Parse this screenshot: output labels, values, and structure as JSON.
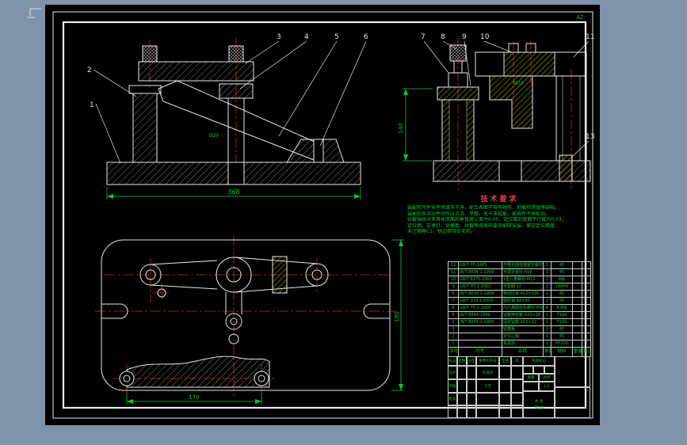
{
  "sheet": {
    "corner_label": "A2"
  },
  "front_view": {
    "callouts": [
      "1",
      "2",
      "3",
      "4",
      "5",
      "6"
    ],
    "dim_width": "368",
    "bore": "Ø20"
  },
  "side_view": {
    "callouts": [
      "7",
      "8",
      "9",
      "10",
      "11",
      "13"
    ],
    "dim_height": "140",
    "thread": "M10"
  },
  "plan_view": {
    "dim_right": "190",
    "dim_bottom": "170"
  },
  "tech_req": {
    "title": "技术要求",
    "lines": [
      "装配前所有零件须清洗干净，配合表面不得有碰伤、划痕和锈蚀等缺陷。",
      "装配后各活动件动作应灵活、平稳、无卡滞现象，紧固件不得松动。",
      "钻套轴线对夹具体底面的垂直度公差为0.05，定位面对底面平行度为0.03。",
      "定位销、支承钉、钻模板、衬套等按图样要求配研安装，保证定位精度。",
      "未注倒角C1，锐边倒钝去毛刺。"
    ]
  },
  "bom": {
    "headers": [
      "序号",
      "代号",
      "名称",
      "数量",
      "材料",
      "重量",
      "备注"
    ],
    "rows": [
      [
        "12",
        "GB/T 75-1985",
        "开槽长圆柱端紧定螺钉 M6×20",
        "1",
        "45",
        "",
        ""
      ],
      [
        "11",
        "JB/T 8004.1-1999",
        "可调支承钉 A16",
        "1",
        "45",
        "",
        ""
      ],
      [
        "10",
        "GB/T 6170-2000",
        "1型六角螺母 M12",
        "2",
        "8级",
        "",
        ""
      ],
      [
        "9",
        "GB/T 97.1-2002",
        "平垫圈 12",
        "2",
        "140HV",
        "",
        ""
      ],
      [
        "8",
        "JB/T 8010.1-1999",
        "移动压板 A12×100",
        "1",
        "45",
        "",
        ""
      ],
      [
        "7",
        "GB/T 119.1-2000",
        "圆柱销 A8×40",
        "2",
        "35",
        "",
        ""
      ],
      [
        "6",
        "GB/T 70.1-2000",
        "内六角圆柱头螺钉 M10×30",
        "4",
        "8.8级",
        "",
        ""
      ],
      [
        "5",
        "JB/T 8044-1999",
        "钻套用衬套 A22×16",
        "1",
        "T10A",
        "",
        ""
      ],
      [
        "4",
        "JB/T 8045.2-1999",
        "固定钻套 A12×22",
        "1",
        "T10A",
        "",
        ""
      ],
      [
        "3",
        "",
        "钻模板",
        "1",
        "45",
        "",
        ""
      ],
      [
        "2",
        "",
        "定位心轴",
        "1",
        "45",
        "",
        ""
      ],
      [
        "1",
        "",
        "夹具体",
        "1",
        "HT200",
        "",
        ""
      ]
    ]
  },
  "title_block": {
    "change_row": [
      "标记",
      "处数",
      "分区",
      "更改文件号",
      "签名",
      "年、月、日"
    ],
    "design_label": "设计",
    "standardize_label": "标准化",
    "audit_label": "审核",
    "process_label": "工艺",
    "approve_label": "批准",
    "stage_label": "阶段标记",
    "weight_label": "重量",
    "scale_label": "比例",
    "scale_value": "1:1",
    "total_sheets": "共 张",
    "sheet_number": "第 张"
  }
}
